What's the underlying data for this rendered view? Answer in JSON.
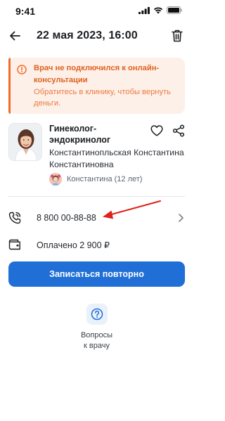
{
  "status_bar": {
    "time": "9:41"
  },
  "header": {
    "title": "22 мая 2023, 16:00"
  },
  "alert": {
    "title": "Врач не подключился к онлайн-консультации",
    "text": "Обратитесь в клинику, чтобы вернуть деньги."
  },
  "doctor": {
    "specialty": "Гинеколог-эндокринолог",
    "name": "Константинопльская Константина Константиновна",
    "patient": "Константина (12 лет)"
  },
  "contact": {
    "phone": "8 800 00-88-88"
  },
  "payment": {
    "text": "Оплачено 2 900 ₽"
  },
  "actions": {
    "rebook_label": "Записаться повторно"
  },
  "questions": {
    "label_line1": "Вопросы",
    "label_line2": "к врачу"
  },
  "colors": {
    "accent": "#1f6fd6",
    "warning": "#f26b2a",
    "annotation": "#e0211c"
  }
}
